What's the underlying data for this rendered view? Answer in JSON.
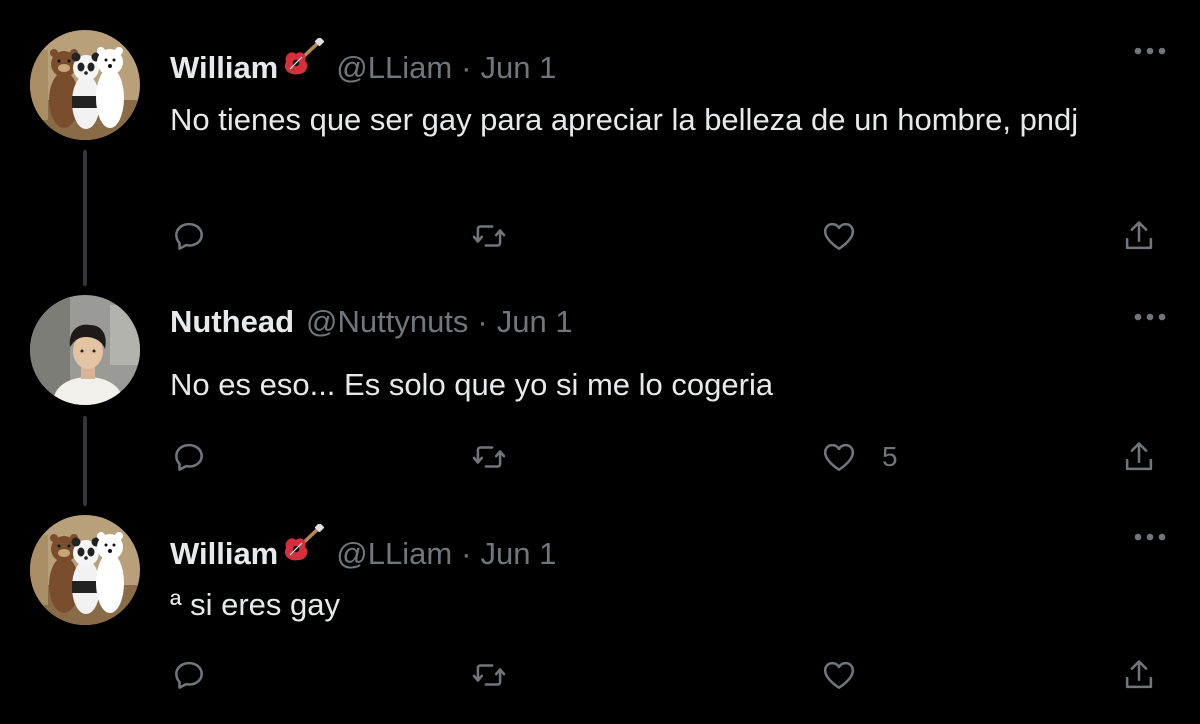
{
  "tweets": [
    {
      "name": "William",
      "handle": "@LLiam",
      "separator": "·",
      "date": "Jun 1",
      "text": "No tienes que ser gay para apreciar la belleza de un hombre, pndj",
      "like_count": "",
      "avatar": "bears-avatar"
    },
    {
      "name": "Nuthead",
      "handle": "@Nuttynuts",
      "separator": "·",
      "date": "Jun 1",
      "text": "No es eso... Es solo que yo si me lo cogeria",
      "like_count": "5",
      "avatar": "person-avatar"
    },
    {
      "name": "William",
      "handle": "@LLiam",
      "separator": "·",
      "date": "Jun 1",
      "text": "ª si eres gay",
      "like_count": "",
      "avatar": "bears-avatar"
    }
  ],
  "icons": {
    "reply": "reply-icon",
    "retweet": "retweet-icon",
    "like": "heart-icon",
    "share": "share-icon",
    "more": "more-icon",
    "name_emoji": "guitar-icon"
  },
  "colors": {
    "background": "#000000",
    "text": "#e7e9ea",
    "secondary": "#71767b",
    "thread_line": "#333639"
  }
}
